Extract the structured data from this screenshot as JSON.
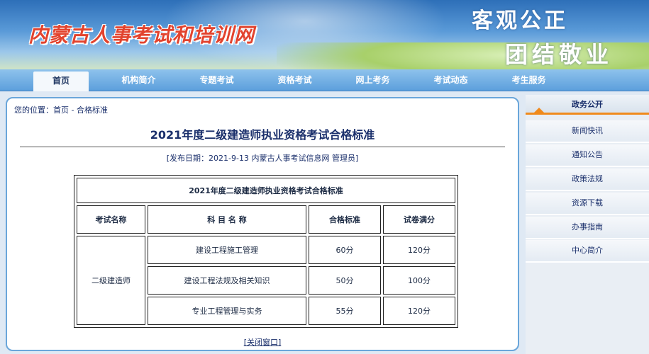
{
  "banner": {
    "site_title": "内蒙古人事考试和培训网",
    "slogan_line1": "客观公正",
    "slogan_line2": "团结敬业"
  },
  "nav": {
    "items": [
      {
        "label": "首页",
        "active": true
      },
      {
        "label": "机构简介"
      },
      {
        "label": "专题考试"
      },
      {
        "label": "资格考试"
      },
      {
        "label": "网上考务"
      },
      {
        "label": "考试动态"
      },
      {
        "label": "考生服务"
      }
    ]
  },
  "breadcrumb": {
    "prefix": "您的位置：",
    "home": "首页",
    "separator": " - ",
    "current": "合格标准"
  },
  "article": {
    "title": "2021年度二级建造师执业资格考试合格标准",
    "meta": "[发布日期：2021-9-13 内蒙古人事考试信息网 管理员]",
    "close_label": "[关闭窗口]"
  },
  "table": {
    "caption": "2021年度二级建造师执业资格考试合格标准",
    "headers": [
      "考试名称",
      "科 目 名 称",
      "合格标准",
      "试卷满分"
    ],
    "exam_name": "二级建造师",
    "rows": [
      {
        "subject": "建设工程施工管理",
        "pass": "60分",
        "full": "120分"
      },
      {
        "subject": "建设工程法规及相关知识",
        "pass": "50分",
        "full": "100分"
      },
      {
        "subject": "专业工程管理与实务",
        "pass": "55分",
        "full": "120分"
      }
    ]
  },
  "sidebar": {
    "header": "政务公开",
    "items": [
      "新闻快讯",
      "通知公告",
      "政策法规",
      "资源下载",
      "办事指南",
      "中心简介"
    ]
  },
  "colors": {
    "accent": "#f08a1c",
    "nav_bg": "#5c9fdc",
    "title_red": "#e2432e",
    "link_blue": "#1a2f6b"
  }
}
